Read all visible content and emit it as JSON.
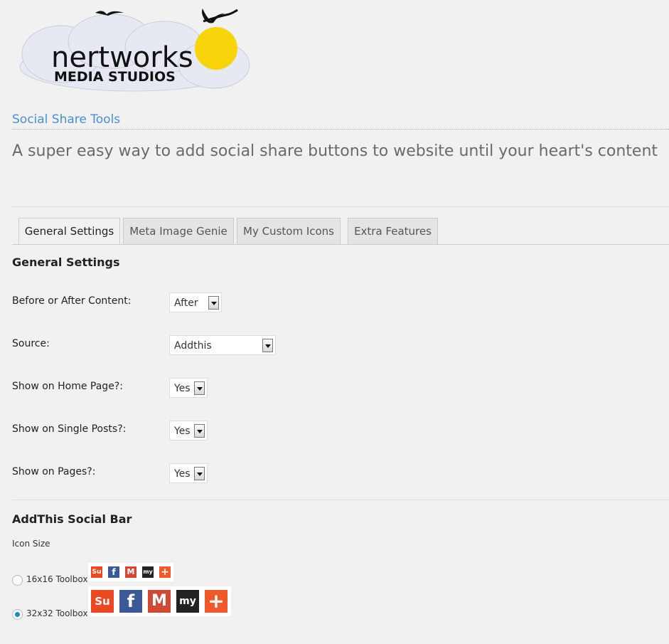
{
  "logo": {
    "line1": "nertworks",
    "line2": "MEDIA STUDIOS"
  },
  "brand": {
    "title": "Social Share Tools"
  },
  "tagline": "A super easy way to add social share buttons to website until your heart's content",
  "tabs": [
    {
      "label": "General Settings",
      "active": true
    },
    {
      "label": "Meta Image Genie",
      "active": false
    },
    {
      "label": "My Custom Icons",
      "active": false
    },
    {
      "label": "Extra Features",
      "active": false
    }
  ],
  "general": {
    "title": "General Settings",
    "fields": [
      {
        "label": "Before or After Content:",
        "value": "After"
      },
      {
        "label": "Source:",
        "value": "Addthis"
      },
      {
        "label": "Show on Home Page?:",
        "value": "Yes"
      },
      {
        "label": "Show on Single Posts?:",
        "value": "Yes"
      },
      {
        "label": "Show on Pages?:",
        "value": "Yes"
      }
    ]
  },
  "addthis": {
    "title": "AddThis Social Bar",
    "icon_size_label": "Icon Size",
    "options": [
      {
        "label": "16x16 Toolbox",
        "checked": false
      },
      {
        "label": "32x32 Toolbox",
        "checked": true
      }
    ],
    "icons": [
      {
        "name": "stumbleupon-icon",
        "glyph": "Su",
        "color": "#eb4924"
      },
      {
        "name": "facebook-icon",
        "glyph": "f",
        "color": "#3b5998"
      },
      {
        "name": "gmail-icon",
        "glyph": "M",
        "color": "#d14836"
      },
      {
        "name": "myspace-icon",
        "glyph": "my",
        "color": "#222222"
      },
      {
        "name": "addthis-more-icon",
        "glyph": "+",
        "color": "#f0592a"
      }
    ]
  }
}
